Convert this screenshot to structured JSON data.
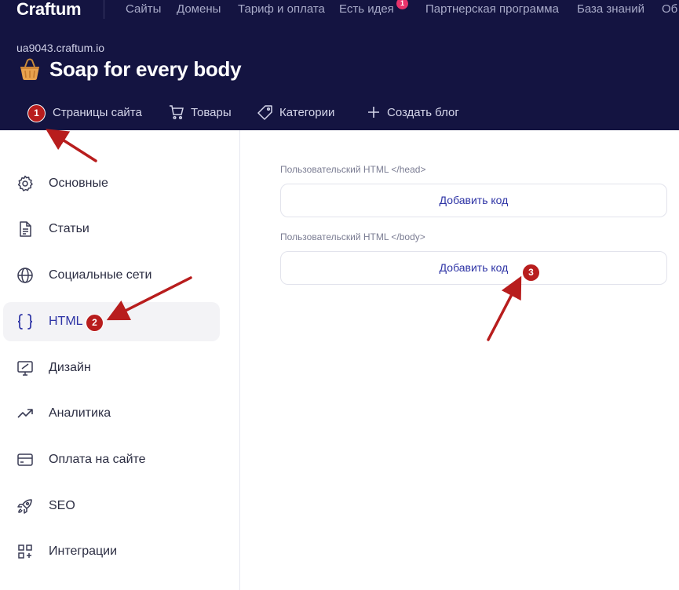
{
  "topnav": {
    "logo": "Craftum",
    "items": [
      "Сайты",
      "Домены",
      "Тариф и оплата",
      "Есть идея",
      "Партнерская программа",
      "База знаний",
      "Об"
    ],
    "idea_badge": "1"
  },
  "site": {
    "domain": "ua9043.craftum.io",
    "title": "Soap for every body"
  },
  "subnav": {
    "pages": "Страницы сайта",
    "products": "Товары",
    "categories": "Категории",
    "blog": "Создать блог"
  },
  "sidebar": {
    "items": [
      {
        "label": "Основные",
        "icon": "gear-icon"
      },
      {
        "label": "Статьи",
        "icon": "document-icon"
      },
      {
        "label": "Социальные сети",
        "icon": "globe-icon"
      },
      {
        "label": "HTML",
        "icon": "code-braces-icon",
        "active": true
      },
      {
        "label": "Дизайн",
        "icon": "design-monitor-icon"
      },
      {
        "label": "Аналитика",
        "icon": "trending-icon"
      },
      {
        "label": "Оплата на сайте",
        "icon": "credit-card-icon"
      },
      {
        "label": "SEO",
        "icon": "rocket-icon"
      },
      {
        "label": "Интеграции",
        "icon": "integrations-grid-icon"
      }
    ]
  },
  "main": {
    "head_label": "Пользовательский HTML </head>",
    "head_button": "Добавить код",
    "body_label": "Пользовательский HTML </body>",
    "body_button": "Добавить код"
  },
  "annotations": {
    "step1": "1",
    "step2": "2",
    "step3": "3"
  },
  "colors": {
    "header_bg": "#141441",
    "accent": "#2d33a5",
    "annotation": "#b81d1d",
    "badge": "#e8336b"
  }
}
